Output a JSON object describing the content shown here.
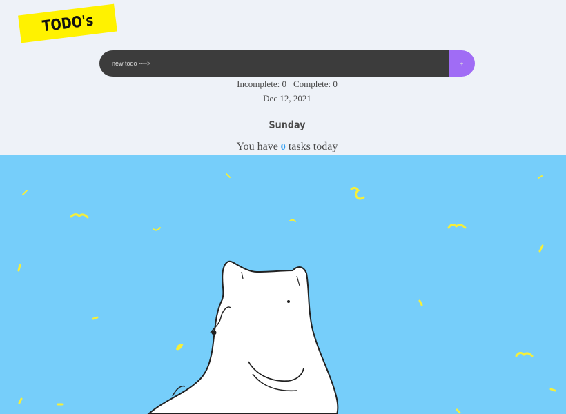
{
  "logo": {
    "text": "TODO's"
  },
  "form": {
    "placeholder": "new todo ---->",
    "button_label": "+"
  },
  "counts": {
    "incomplete": "Incomplete: 0",
    "complete": "Complete: 0"
  },
  "date": "Dec 12, 2021",
  "day": "Sunday",
  "tasks": {
    "prefix": "You have ",
    "count": "0",
    "suffix": " tasks today"
  },
  "colors": {
    "background": "#eef2f8",
    "logo_bg": "#fff200",
    "input_bg": "#3c3c3c",
    "button_bg": "#a06cf5",
    "count_accent": "#2d9cf0",
    "illustration_bg": "#76cefa",
    "confetti": "#f5ef3a"
  },
  "illustration": {
    "icon": "polar-bear-illustration"
  }
}
